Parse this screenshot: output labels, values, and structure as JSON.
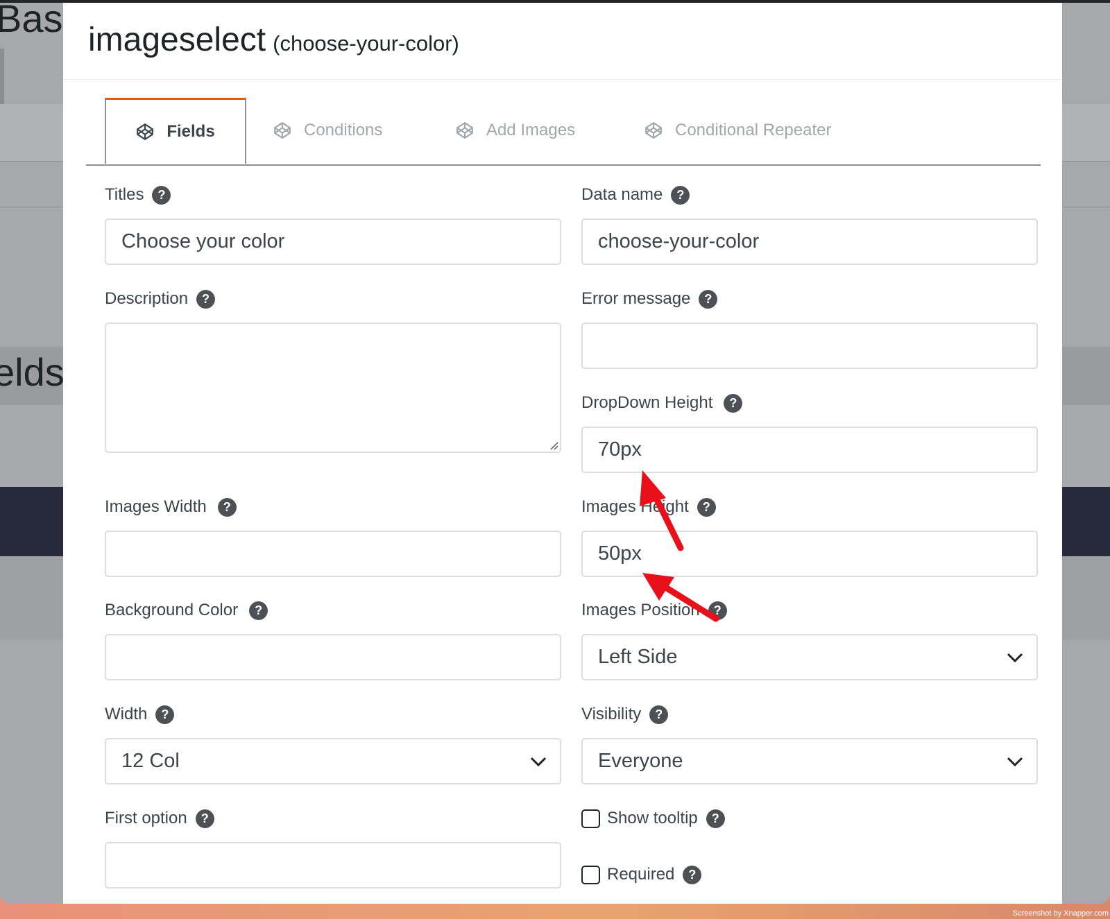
{
  "background": {
    "heading_fragment_1": "Bas",
    "heading_fragment_2": "elds"
  },
  "modal": {
    "title": "imageselect",
    "subtitle": "(choose-your-color)"
  },
  "tabs": [
    {
      "label": "Fields",
      "active": true,
      "icon": "codepen-icon"
    },
    {
      "label": "Conditions",
      "active": false,
      "icon": "codepen-icon"
    },
    {
      "label": "Add Images",
      "active": false,
      "icon": "codepen-icon"
    },
    {
      "label": "Conditional Repeater",
      "active": false,
      "icon": "codepen-icon"
    }
  ],
  "fields": {
    "titles": {
      "label": "Titles",
      "value": "Choose your color"
    },
    "data_name": {
      "label": "Data name",
      "value": "choose-your-color"
    },
    "description": {
      "label": "Description",
      "value": ""
    },
    "error_message": {
      "label": "Error message",
      "value": ""
    },
    "dropdown_height": {
      "label": "DropDown Height",
      "value": "70px"
    },
    "images_width": {
      "label": "Images Width",
      "value": ""
    },
    "images_height": {
      "label": "Images Height",
      "value": "50px"
    },
    "background_color": {
      "label": "Background Color",
      "value": ""
    },
    "images_position": {
      "label": "Images Position",
      "value": "Left Side"
    },
    "width": {
      "label": "Width",
      "value": "12 Col"
    },
    "visibility": {
      "label": "Visibility",
      "value": "Everyone"
    },
    "first_option": {
      "label": "First option",
      "value": ""
    },
    "show_tooltip": {
      "label": "Show tooltip",
      "checked": false
    },
    "required": {
      "label": "Required",
      "checked": false
    }
  },
  "help_glyph": "?",
  "colors": {
    "accent_tab": "#e8590c",
    "annotation_arrow": "#e8101a",
    "help_icon_bg": "#4d5156"
  },
  "watermark": "Screenshot by Xnapper.com"
}
